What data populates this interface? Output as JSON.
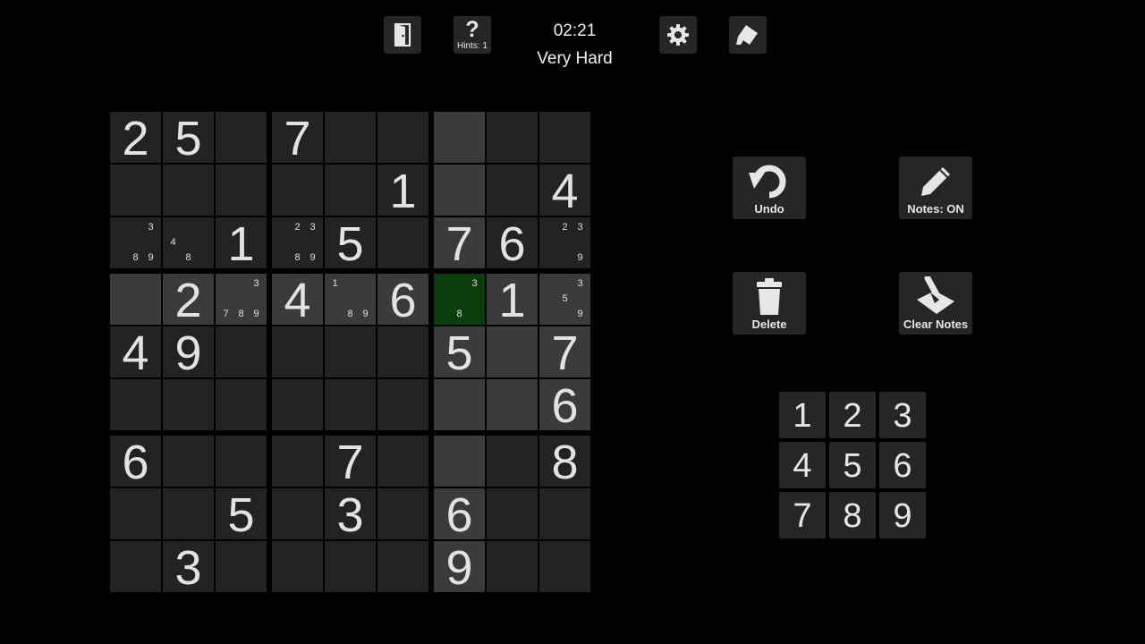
{
  "header": {
    "hint_symbol": "?",
    "hints_label": "Hints: 1",
    "timer": "02:21",
    "difficulty": "Very Hard",
    "icons": [
      "exit-door-icon",
      "help-question-icon",
      "gear-icon",
      "eraser-icon"
    ]
  },
  "board": {
    "values": [
      [
        2,
        5,
        0,
        7,
        0,
        0,
        0,
        0,
        0
      ],
      [
        0,
        0,
        0,
        0,
        0,
        1,
        0,
        0,
        4
      ],
      [
        0,
        0,
        1,
        0,
        5,
        0,
        7,
        6,
        0
      ],
      [
        0,
        2,
        0,
        4,
        0,
        6,
        0,
        1,
        0
      ],
      [
        4,
        9,
        0,
        0,
        0,
        0,
        5,
        0,
        7
      ],
      [
        0,
        0,
        0,
        0,
        0,
        0,
        0,
        0,
        6
      ],
      [
        6,
        0,
        0,
        0,
        7,
        0,
        0,
        0,
        8
      ],
      [
        0,
        0,
        5,
        0,
        3,
        0,
        6,
        0,
        0
      ],
      [
        0,
        3,
        0,
        0,
        0,
        0,
        9,
        0,
        0
      ]
    ],
    "notes": [
      {
        "row": 2,
        "col": 0,
        "digits": [
          3,
          8,
          9
        ]
      },
      {
        "row": 2,
        "col": 1,
        "digits": [
          4,
          8
        ]
      },
      {
        "row": 2,
        "col": 3,
        "digits": [
          2,
          3,
          8,
          9
        ]
      },
      {
        "row": 2,
        "col": 8,
        "digits": [
          2,
          3,
          9
        ]
      },
      {
        "row": 3,
        "col": 2,
        "digits": [
          3,
          7,
          8,
          9
        ]
      },
      {
        "row": 3,
        "col": 4,
        "digits": [
          1,
          8,
          9
        ]
      },
      {
        "row": 3,
        "col": 6,
        "digits": [
          3,
          8
        ]
      },
      {
        "row": 3,
        "col": 8,
        "digits": [
          3,
          5,
          9
        ]
      }
    ],
    "selected": {
      "row": 3,
      "col": 6
    },
    "highlighted": [
      [
        0,
        6
      ],
      [
        1,
        6
      ],
      [
        2,
        6
      ],
      [
        4,
        6
      ],
      [
        5,
        6
      ],
      [
        6,
        6
      ],
      [
        7,
        6
      ],
      [
        8,
        6
      ],
      [
        3,
        0
      ],
      [
        3,
        1
      ],
      [
        3,
        2
      ],
      [
        3,
        3
      ],
      [
        3,
        4
      ],
      [
        3,
        5
      ],
      [
        3,
        7
      ],
      [
        3,
        8
      ],
      [
        4,
        7
      ],
      [
        4,
        8
      ],
      [
        5,
        7
      ],
      [
        5,
        8
      ]
    ],
    "colors": {
      "cell": "#232323",
      "highlight": "#3b3b3b",
      "selected": "#0d3d0d",
      "background": "#000000"
    }
  },
  "actions": {
    "undo_label": "Undo",
    "notes_label": "Notes: ON",
    "delete_label": "Delete",
    "clear_notes_label": "Clear Notes",
    "icons": [
      "undo-icon",
      "pencil-icon",
      "trash-icon",
      "clear-notes-icon"
    ]
  },
  "numpad": [
    "1",
    "2",
    "3",
    "4",
    "5",
    "6",
    "7",
    "8",
    "9"
  ]
}
